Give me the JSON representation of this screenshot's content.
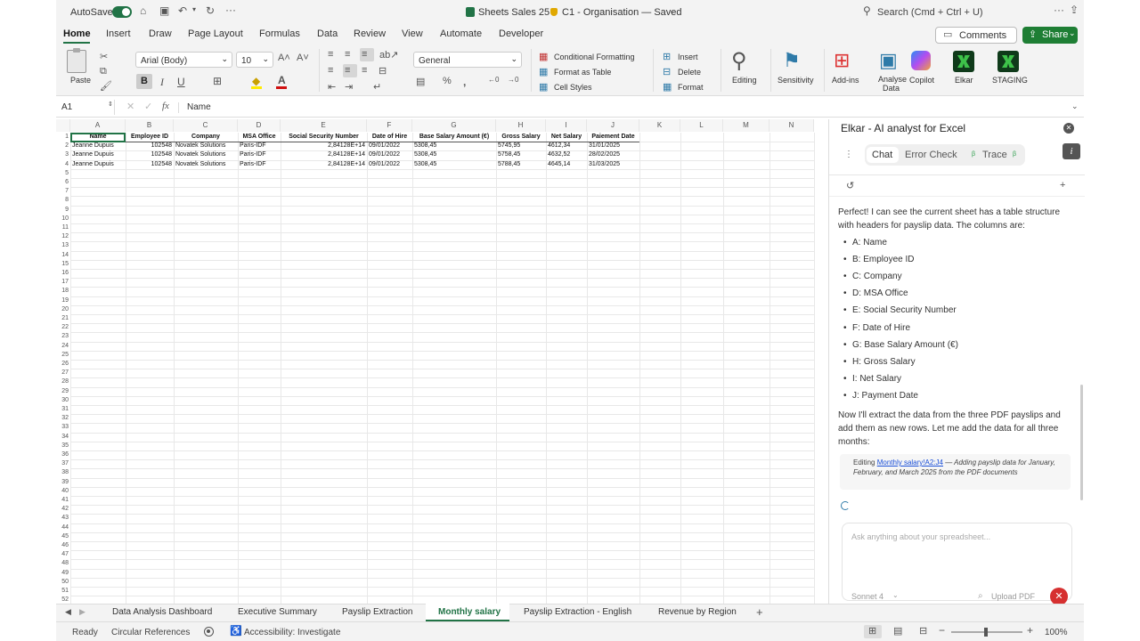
{
  "titlebar": {
    "autosave_label": "AutoSave",
    "file_name": "Sheets Sales 25",
    "location": "C1 - Organisation — Saved",
    "search_placeholder": "Search (Cmd + Ctrl + U)"
  },
  "menu_tabs": [
    "Home",
    "Insert",
    "Draw",
    "Page Layout",
    "Formulas",
    "Data",
    "Review",
    "View",
    "Automate",
    "Developer"
  ],
  "active_tab": "Home",
  "comments_label": "Comments",
  "share_label": "Share",
  "ribbon": {
    "paste": "Paste",
    "font_name": "Arial (Body)",
    "font_size": "10",
    "number_format": "General",
    "conditional_formatting": "Conditional Formatting",
    "format_as_table": "Format as Table",
    "cell_styles": "Cell Styles",
    "insert": "Insert",
    "delete": "Delete",
    "format": "Format",
    "editing": "Editing",
    "sensitivity": "Sensitivity",
    "addins": "Add-ins",
    "analyse_data_1": "Analyse",
    "analyse_data_2": "Data",
    "copilot": "Copilot",
    "elkar": "Elkar",
    "staging": "STAGING"
  },
  "formula": {
    "cell_ref": "A1",
    "fx": "fx",
    "content": "Name"
  },
  "sheet": {
    "columns": [
      "A",
      "B",
      "C",
      "D",
      "E",
      "F",
      "G",
      "H",
      "I",
      "J",
      "K",
      "L",
      "M",
      "N"
    ],
    "headers": [
      "Name",
      "Employee ID",
      "Company",
      "MSA Office",
      "Social Security Number",
      "Date of Hire",
      "Base Salary Amount (€)",
      "Gross Salary",
      "Net Salary",
      "Paiement Date"
    ],
    "rows": [
      [
        "Jeanne Dupuis",
        "102548",
        "Novatek Solutions",
        "Paris-IDF",
        "2,84128E+14",
        "09/01/2022",
        "5308,45",
        "5745,95",
        "4612,34",
        "31/01/2025"
      ],
      [
        "Jeanne Dupuis",
        "102548",
        "Novatek Solutions",
        "Paris-IDF",
        "2,84128E+14",
        "09/01/2022",
        "5308,45",
        "5758,45",
        "4632,52",
        "28/02/2025"
      ],
      [
        "Jeanne Dupuis",
        "102548",
        "Novatek Solutions",
        "Paris-IDF",
        "2,84128E+14",
        "09/01/2022",
        "5308,45",
        "5788,45",
        "4645,14",
        "31/03/2025"
      ]
    ],
    "row_numbers": [
      "1",
      "2",
      "3",
      "4",
      "5",
      "6",
      "7",
      "8",
      "9",
      "10",
      "11",
      "12",
      "13",
      "14",
      "15",
      "16",
      "17",
      "18",
      "19",
      "20",
      "21",
      "22",
      "23",
      "24",
      "25",
      "26",
      "27",
      "28",
      "29",
      "30",
      "31",
      "32",
      "33",
      "34",
      "35",
      "36",
      "37",
      "38",
      "39",
      "40",
      "41",
      "42",
      "43",
      "44",
      "45",
      "46",
      "47",
      "48",
      "49",
      "50",
      "51",
      "52"
    ]
  },
  "panel": {
    "title": "Elkar - AI analyst for Excel",
    "tabs": [
      "Chat",
      "Error Check",
      "Trace"
    ],
    "active_tab": "Chat",
    "beta_mark": "β",
    "intro": "Perfect! I can see the current sheet has a table structure with headers for payslip data. The columns are:",
    "columns_list": [
      "A: Name",
      "B: Employee ID",
      "C: Company",
      "D: MSA Office",
      "E: Social Security Number",
      "F: Date of Hire",
      "G: Base Salary Amount (€)",
      "H: Gross Salary",
      "I: Net Salary",
      "J: Payment Date"
    ],
    "followup": "Now I'll extract the data from the three PDF payslips and add them as new rows. Let me add the data for all three months:",
    "edit_prefix": "Editing",
    "edit_link": "Monthly salary!A2:J4",
    "edit_desc": "— Adding payslip data for January, February, and March 2025 from the PDF documents",
    "input_placeholder": "Ask anything about your spreadsheet...",
    "model": "Sonnet 4",
    "upload": "Upload PDF"
  },
  "sheet_tabs": [
    "Data Analysis Dashboard",
    "Executive Summary",
    "Payslip Extraction",
    "Monthly salary",
    "Payslip Extraction - English",
    "Revenue by Region"
  ],
  "active_sheet": "Monthly salary",
  "status": {
    "ready": "Ready",
    "circular": "Circular References",
    "accessibility": "Accessibility: Investigate",
    "zoom": "100%"
  },
  "colors": {
    "accent": "#217346",
    "share_green": "#1e7e34",
    "link": "#1a4fd8",
    "stop_red": "#d63030"
  }
}
